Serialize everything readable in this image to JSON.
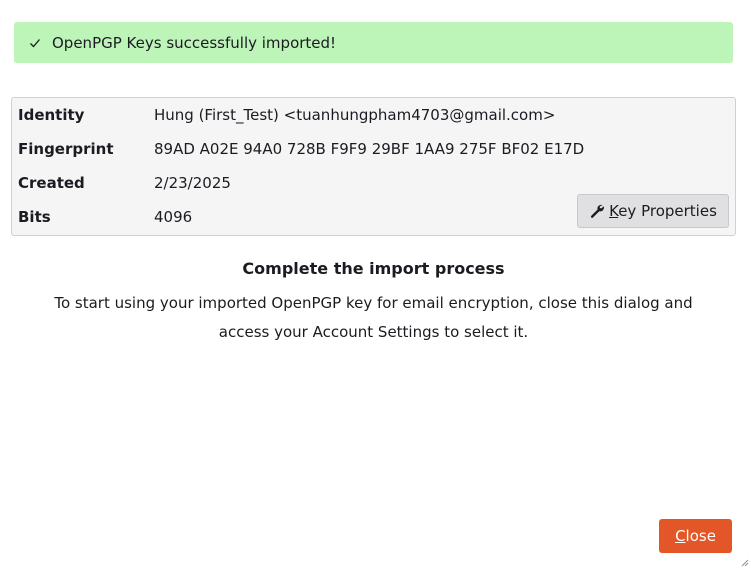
{
  "banner": {
    "message": "OpenPGP Keys successfully imported!",
    "icon": "check-icon",
    "color": "#bdf5b9"
  },
  "key": {
    "rows": [
      {
        "label": "Identity",
        "value": "Hung (First_Test) <tuanhungpham4703@gmail.com>"
      },
      {
        "label": "Fingerprint",
        "value": "89AD A02E 94A0 728B F9F9 29BF 1AA9 275F BF02 E17D"
      },
      {
        "label": "Created",
        "value": "2/23/2025"
      },
      {
        "label": "Bits",
        "value": "4096"
      }
    ],
    "properties_button": {
      "accesskey": "K",
      "label_rest": "ey Properties",
      "icon": "wrench-icon"
    }
  },
  "completion": {
    "title": "Complete the import process",
    "description": "To start using your imported OpenPGP key for email encryption, close this dialog and access your Account Settings to select it."
  },
  "footer": {
    "close_accesskey": "C",
    "close_rest": "lose",
    "close_color": "#e35627"
  }
}
